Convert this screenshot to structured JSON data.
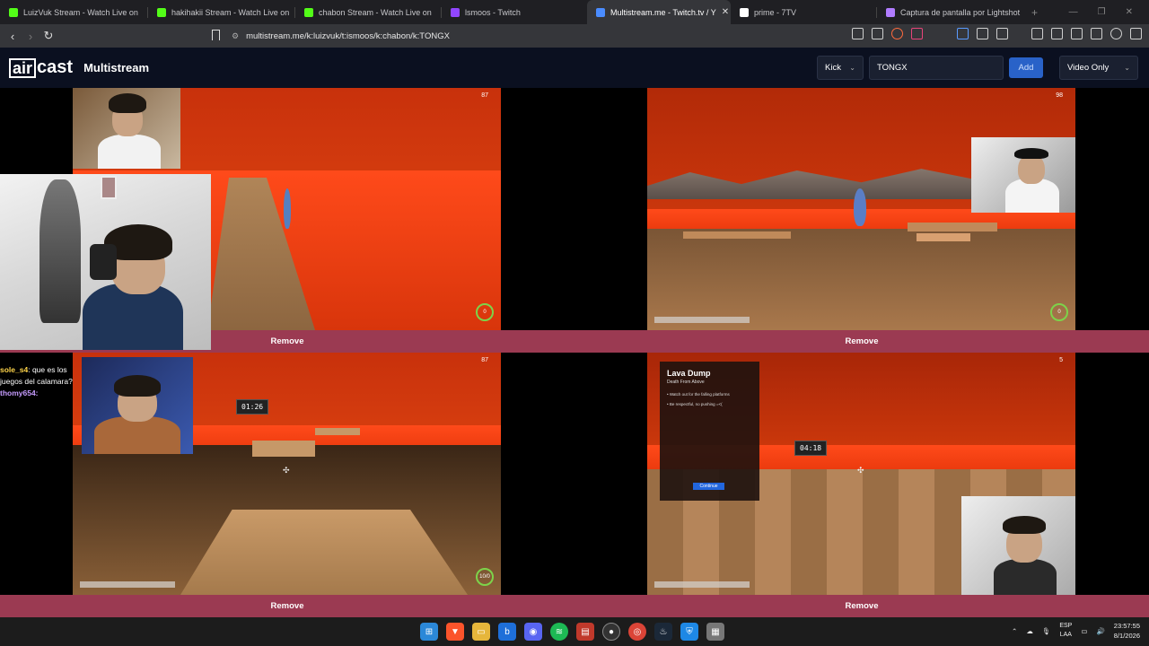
{
  "browser": {
    "tabs": [
      {
        "title": "LuizVuk Stream - Watch Live on",
        "color": "#53fc18"
      },
      {
        "title": "hakihakii Stream - Watch Live on",
        "color": "#53fc18"
      },
      {
        "title": "chabon Stream - Watch Live on",
        "color": "#53fc18"
      },
      {
        "title": "lsmoos - Twitch",
        "color": "#9146ff"
      },
      {
        "title": "Multistream.me - Twitch.tv / Y",
        "color": "#4a8cff",
        "active": true
      },
      {
        "title": "prime - 7TV",
        "color": "#ffffff"
      },
      {
        "title": "Captura de pantalla por Lightshot",
        "color": "#b07cff"
      }
    ],
    "url": "multistream.me/k:luizvuk/t:ismoos/k:chabon/k:TONGX"
  },
  "app": {
    "logo_box": "air",
    "logo_rest": "cast",
    "title": "Multistream",
    "platform_select": "Kick",
    "channel_input": "TONGX",
    "add_label": "Add",
    "mode_select": "Video Only"
  },
  "streams": [
    {
      "remove_label": "Remove",
      "viewer_count": "87",
      "ring": "0"
    },
    {
      "remove_label": "Remove",
      "viewer_count": "98",
      "ring": "0"
    },
    {
      "remove_label": "Remove",
      "viewer_count": "87",
      "ring": "10/0",
      "timer": "01:26"
    },
    {
      "remove_label": "Remove",
      "viewer_count": "5",
      "timer": "04:18"
    }
  ],
  "info_panel": {
    "title": "Lava Dump",
    "subtitle": "Death From Above",
    "line1": "• Watch out for the falling platforms",
    "line2": "• Be respectful, no pushing =<(",
    "button": "Continue"
  },
  "chat": {
    "user1": "sole_s4",
    "msg1": "que es los juegos del calamara?",
    "user2": "thomy654:"
  },
  "taskbar": {
    "lang_top": "ESP",
    "lang_bottom": "LAA",
    "time": "23:57:55",
    "date": "8/1/2026"
  }
}
